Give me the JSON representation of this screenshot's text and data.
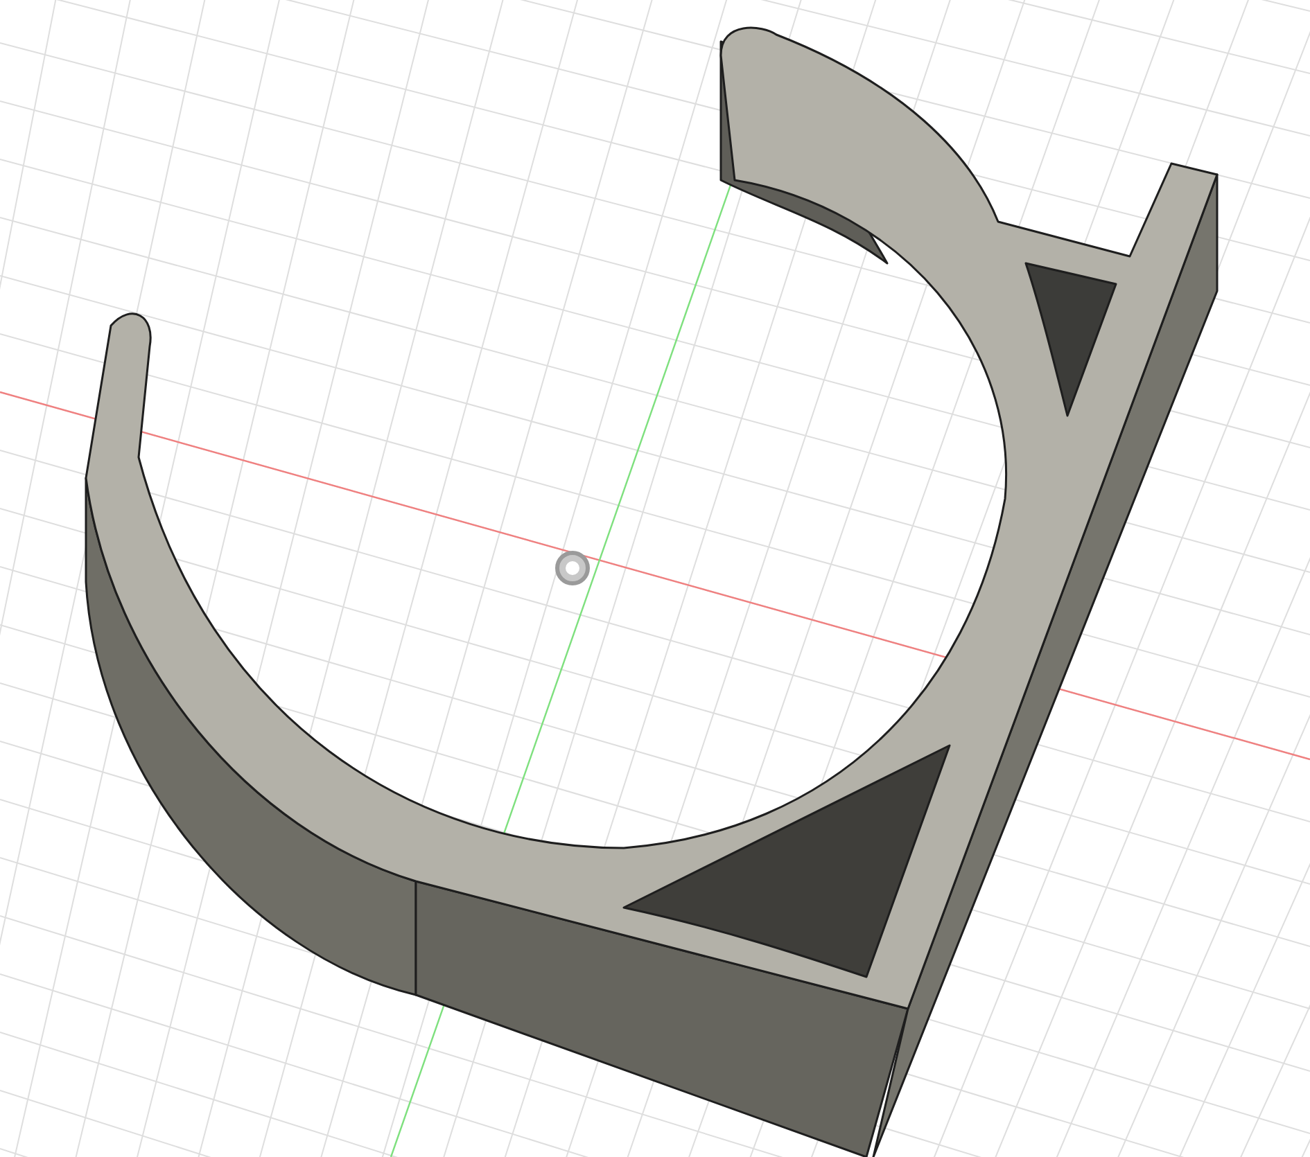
{
  "viewport": {
    "axes": [
      {
        "kind": "x",
        "color": "#f08080"
      },
      {
        "kind": "y",
        "color": "#7ee07e"
      }
    ]
  }
}
